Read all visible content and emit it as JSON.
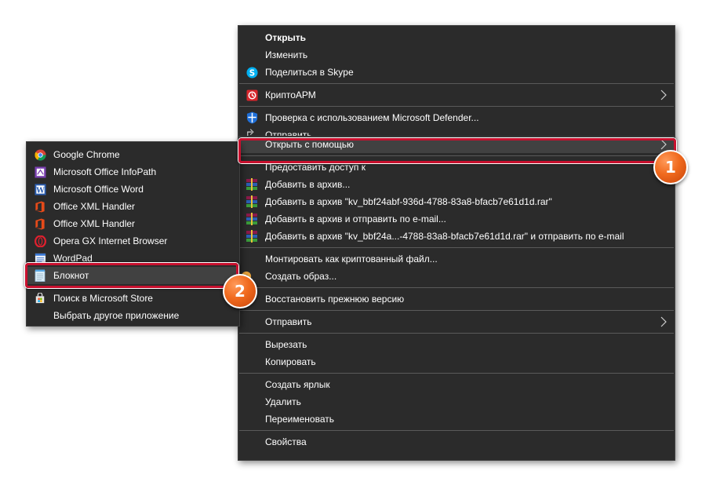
{
  "main_menu": {
    "open": "Открыть",
    "edit": "Изменить",
    "share_skype": "Поделиться в Skype",
    "crypto_arm": "КриптоАРМ",
    "defender_scan": "Проверка с использованием Microsoft Defender...",
    "send_partial": "Отправить",
    "open_with": "Открыть с помощью",
    "grant_access": "Предоставить доступ к",
    "add_archive": "Добавить в архив...",
    "add_named_archive": "Добавить в архив \"kv_bbf24abf-936d-4788-83a8-bfacb7e61d1d.rar\"",
    "add_archive_email": "Добавить в архив и отправить по e-mail...",
    "add_named_archive_email": "Добавить в архив \"kv_bbf24a...-4788-83a8-bfacb7e61d1d.rar\" и отправить по e-mail",
    "mount_crypto": "Монтировать как криптованный файл...",
    "create_image": "Создать образ...",
    "restore_version": "Восстановить прежнюю версию",
    "send_to": "Отправить",
    "cut": "Вырезать",
    "copy": "Копировать",
    "create_shortcut": "Создать ярлык",
    "delete": "Удалить",
    "rename": "Переименовать",
    "properties": "Свойства"
  },
  "submenu": {
    "chrome": "Google Chrome",
    "infopath": "Microsoft Office InfoPath",
    "word": "Microsoft Office Word",
    "xml_handler_1": "Office XML Handler",
    "xml_handler_2": "Office XML Handler",
    "opera": "Opera GX Internet Browser",
    "wordpad": "WordPad",
    "notepad": "Блокнот",
    "store": "Поиск в Microsoft Store",
    "choose_other": "Выбрать другое приложение"
  },
  "badges": {
    "step1": "1",
    "step2": "2"
  },
  "colors": {
    "menu_bg": "#2b2b2b",
    "highlight": "#414141",
    "callout_red": "#c8102e",
    "badge_orange": "#f06a1e"
  }
}
